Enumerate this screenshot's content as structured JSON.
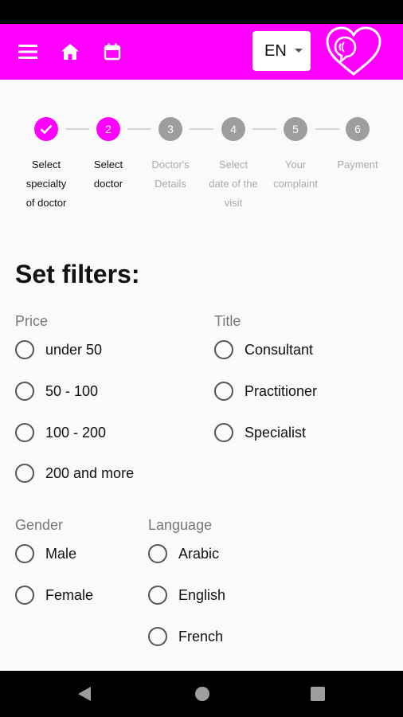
{
  "header": {
    "language": "EN",
    "accent": "#ff00ff"
  },
  "icons": {
    "menu": "menu-icon",
    "home": "home-icon",
    "calendar": "calendar-icon",
    "logo": "heart-chat-logo",
    "check": "check-icon"
  },
  "stepper": {
    "steps": [
      {
        "number": "",
        "state": "done",
        "label_lines": [
          "Select",
          "specialty",
          "of doctor"
        ]
      },
      {
        "number": "2",
        "state": "active",
        "label_lines": [
          "Select",
          "doctor"
        ]
      },
      {
        "number": "3",
        "state": "inactive",
        "label_lines": [
          "Doctor's",
          "Details"
        ]
      },
      {
        "number": "4",
        "state": "inactive",
        "label_lines": [
          "Select",
          "date of the",
          "visit"
        ]
      },
      {
        "number": "5",
        "state": "inactive",
        "label_lines": [
          "Your",
          "complaint"
        ]
      },
      {
        "number": "6",
        "state": "inactive",
        "label_lines": [
          "Payment"
        ]
      }
    ]
  },
  "filters": {
    "title": "Set filters:",
    "price": {
      "label": "Price",
      "options": [
        "under 50",
        "50 - 100",
        "100 - 200",
        "200 and more"
      ]
    },
    "doctor_title": {
      "label": "Title",
      "options": [
        "Consultant",
        "Practitioner",
        "Specialist"
      ]
    },
    "gender": {
      "label": "Gender",
      "options": [
        "Male",
        "Female"
      ]
    },
    "language": {
      "label": "Language",
      "options": [
        "Arabic",
        "English",
        "French"
      ]
    }
  }
}
